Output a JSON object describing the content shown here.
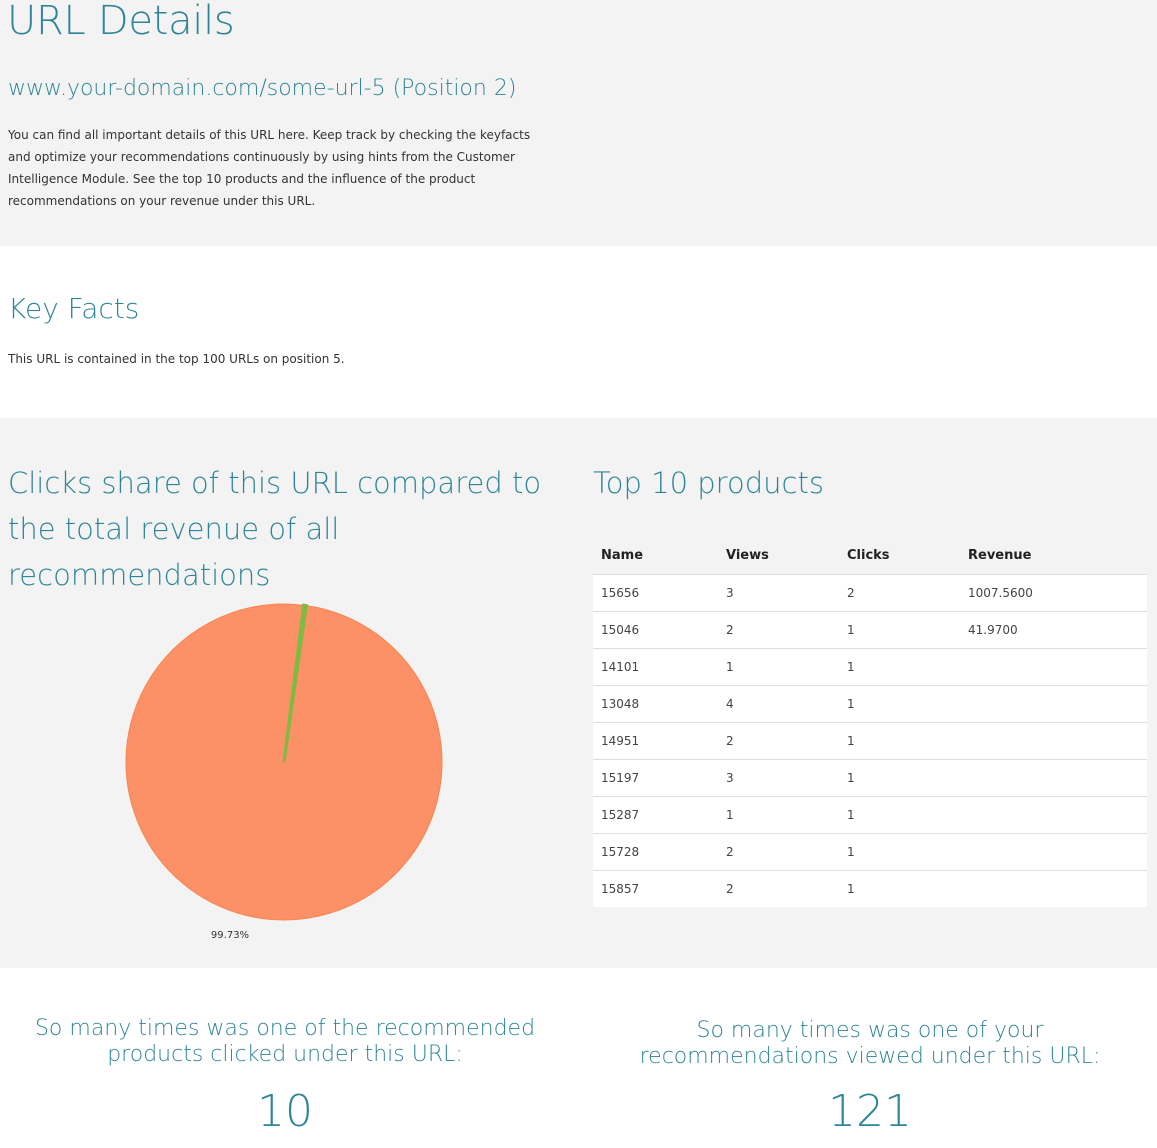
{
  "header": {
    "title": "URL Details",
    "url_subtitle": "www.your-domain.com/some-url-5 (Position 2)",
    "intro": "You can find all important details of this URL here. Keep track by checking the keyfacts and optimize your recommendations continuously by using hints from the Customer Intelligence Module. See the top 10 products and the influence of the product recommendations on your revenue under this URL."
  },
  "key_facts": {
    "title": "Key Facts",
    "text": "This URL is contained in the top 100 URLs on position 5."
  },
  "pie_section": {
    "title": "Clicks share of this URL compared to the total revenue of all recommendations"
  },
  "chart_data": {
    "type": "pie",
    "slices": [
      {
        "label": "99.73%",
        "value": 99.73,
        "color": "#fc9066"
      },
      {
        "label": "",
        "value": 0.27,
        "color": "#7fba42"
      }
    ],
    "data_labels": [
      "99.73%"
    ]
  },
  "top10": {
    "title": "Top 10 products",
    "columns": [
      "Name",
      "Views",
      "Clicks",
      "Revenue"
    ],
    "rows": [
      [
        "15656",
        "3",
        "2",
        "1007.5600"
      ],
      [
        "15046",
        "2",
        "1",
        "41.9700"
      ],
      [
        "14101",
        "1",
        "1",
        ""
      ],
      [
        "13048",
        "4",
        "1",
        ""
      ],
      [
        "14951",
        "2",
        "1",
        ""
      ],
      [
        "15197",
        "3",
        "1",
        ""
      ],
      [
        "15287",
        "1",
        "1",
        ""
      ],
      [
        "15728",
        "2",
        "1",
        ""
      ],
      [
        "15857",
        "2",
        "1",
        ""
      ]
    ]
  },
  "counters": {
    "clicked_label": "So many times was one of the recommended products clicked under this URL:",
    "clicked_value": "10",
    "viewed_label": "So many times was one of your recommendations viewed under this URL:",
    "viewed_value": "121"
  },
  "colors": {
    "accent": "#2e8597",
    "pie_main": "#fc9066",
    "pie_small": "#7fba42"
  }
}
